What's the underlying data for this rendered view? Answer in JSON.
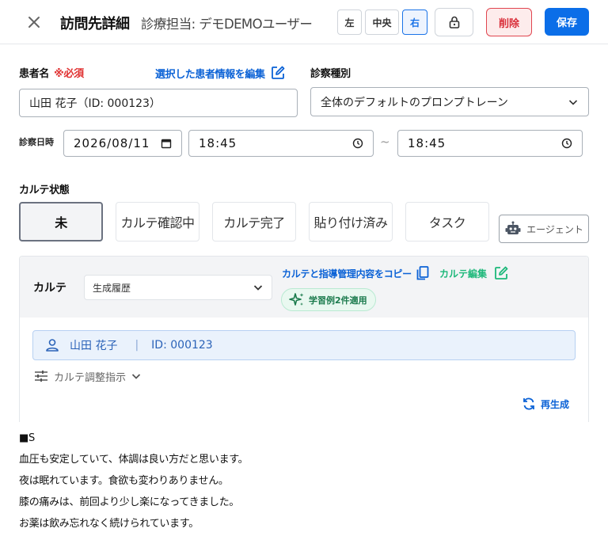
{
  "header": {
    "title": "訪問先詳細",
    "subtitle": "診療担当: デモDEMOユーザー",
    "pos_left": "左",
    "pos_center": "中央",
    "pos_right": "右",
    "delete_label": "削除",
    "save_label": "保存"
  },
  "patient": {
    "label": "患者名",
    "required": "※必須",
    "edit_link": "選択した患者情報を編集",
    "value": "山田 花子（ID: 000123）"
  },
  "exam_type": {
    "label": "診察種別",
    "selected": "全体のデフォルトのプロンプトレーン"
  },
  "datetime": {
    "label": "診察日時",
    "date": "2026/08/11",
    "start": "18:45",
    "separator": "~",
    "end": "18:45"
  },
  "karte_status": {
    "label": "カルテ状態",
    "options": [
      "未",
      "カルテ確認中",
      "カルテ完了",
      "貼り付け済み",
      "タスク"
    ],
    "selected_index": 0,
    "agent_label": "エージェント"
  },
  "karte": {
    "title": "カルテ",
    "history_select": "生成履歴",
    "copy_link": "カルテと指導管理内容をコピー",
    "edit_link": "カルテ編集",
    "learn_badge": "学習例2件適用",
    "patient_name": "山田 花子",
    "patient_sep": "|",
    "patient_id": "ID: 000123",
    "adjust_label": "カルテ調整指示",
    "regen_label": "再生成"
  },
  "note": {
    "heading": "■S",
    "lines": [
      "血圧も安定していて、体調は良い方だと思います。",
      "夜は眠れています。食欲も変わりありません。",
      "膝の痛みは、前回より少し楽になってきました。",
      "お薬は飲み忘れなく続けられています。"
    ]
  },
  "colors": {
    "primary": "#0b6ee8",
    "danger": "#d9303b",
    "accent_green": "#1db87a"
  }
}
